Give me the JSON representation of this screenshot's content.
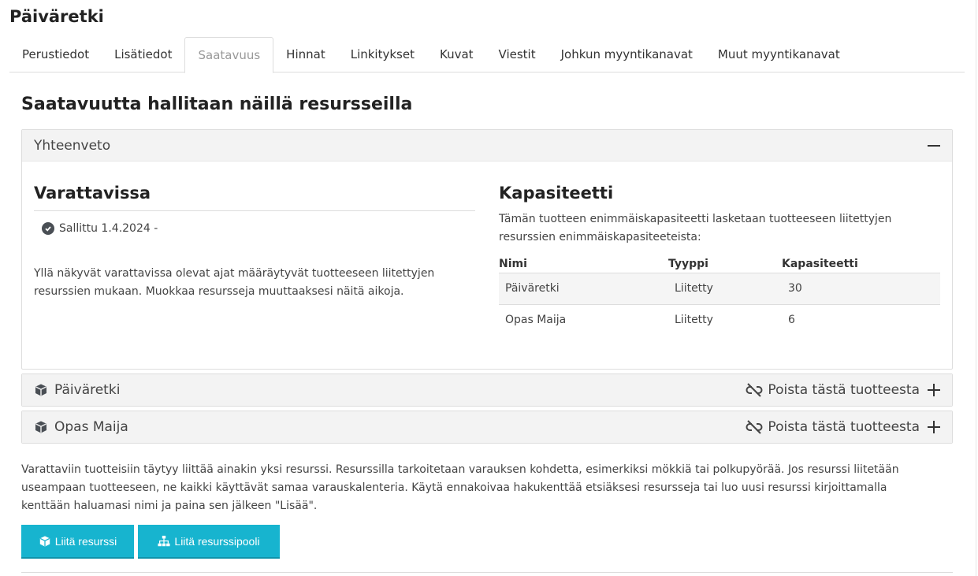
{
  "page": {
    "title": "Päiväretki"
  },
  "tabs": [
    {
      "label": "Perustiedot"
    },
    {
      "label": "Lisätiedot"
    },
    {
      "label": "Saatavuus"
    },
    {
      "label": "Hinnat"
    },
    {
      "label": "Linkitykset"
    },
    {
      "label": "Kuvat"
    },
    {
      "label": "Viestit"
    },
    {
      "label": "Johkun myyntikanavat"
    },
    {
      "label": "Muut myyntikanavat"
    }
  ],
  "active_tab": "Saatavuus",
  "section": {
    "heading": "Saatavuutta hallitaan näillä resursseilla"
  },
  "summary": {
    "header": "Yhteenveto",
    "bookable": {
      "title": "Varattavissa",
      "status": "Sallittu 1.4.2024 -",
      "info": "Yllä näkyvät varattavissa olevat ajat määräytyvät tuotteeseen liitettyjen resurssien mukaan. Muokkaa resursseja muuttaaksesi näitä aikoja."
    },
    "capacity": {
      "title": "Kapasiteetti",
      "description": "Tämän tuotteen enimmäiskapasiteetti lasketaan tuotteeseen liitettyjen resurssien enimmäiskapasiteeteista:",
      "columns": [
        "Nimi",
        "Tyyppi",
        "Kapasiteetti"
      ],
      "rows": [
        [
          "Päiväretki",
          "Liitetty",
          "30"
        ],
        [
          "Opas Maija",
          "Liitetty",
          "6"
        ]
      ]
    }
  },
  "resources": [
    {
      "name": "Päiväretki",
      "action": "Poista tästä tuotteesta"
    },
    {
      "name": "Opas Maija",
      "action": "Poista tästä tuotteesta"
    }
  ],
  "help_text": "Varattaviin tuotteisiin täytyy liittää ainakin yksi resurssi. Resurssilla tarkoitetaan varauksen kohdetta, esimerkiksi mökkiä tai polkupyörää. Jos resurssi liitetään useampaan tuotteeseen, ne kaikki käyttävät samaa varauskalenteria. Käytä ennakoivaa hakukenttää etsiäksesi resursseja tai luo uusi resurssi kirjoittamalla kenttään haluamasi nimi ja paina sen jälkeen \"Lisää\".",
  "buttons": {
    "attach_resource": "Liitä resurssi",
    "attach_pool": "Liitä resurssipooli"
  },
  "colors": {
    "button": "#17b4cf",
    "panel_header": "#f3f3f3"
  }
}
